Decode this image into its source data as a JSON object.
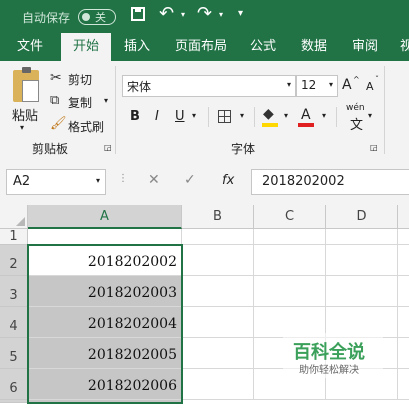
{
  "titlebar": {
    "autosave_label": "自动保存",
    "toggle_state": "关"
  },
  "tabs": [
    "文件",
    "开始",
    "插入",
    "页面布局",
    "公式",
    "数据",
    "审阅",
    "视"
  ],
  "clipboard": {
    "paste": "粘贴",
    "cut": "剪切",
    "copy": "复制",
    "format_painter": "格式刷",
    "group": "剪贴板"
  },
  "font": {
    "name": "宋体",
    "size": "12",
    "bold": "B",
    "italic": "I",
    "underline": "U",
    "group": "字体",
    "grow": "A",
    "shrink": "A",
    "phonetic": "wén"
  },
  "formula_bar": {
    "name_box": "A2",
    "cancel": "✕",
    "enter": "✓",
    "fx": "fx",
    "content": "2018202002"
  },
  "columns": [
    "A",
    "B",
    "C",
    "D"
  ],
  "rows": [
    {
      "num": "1",
      "a": ""
    },
    {
      "num": "2",
      "a": "2018202002"
    },
    {
      "num": "3",
      "a": "2018202003"
    },
    {
      "num": "4",
      "a": "2018202004"
    },
    {
      "num": "5",
      "a": "2018202005"
    },
    {
      "num": "6",
      "a": "2018202006"
    }
  ],
  "watermark": {
    "title": "百科全说",
    "subtitle": "助你轻松解决"
  },
  "colors": {
    "accent": "#217346",
    "selection": "#c6c6c6",
    "font_color": "#e02020",
    "highlight": "#ffd800"
  }
}
